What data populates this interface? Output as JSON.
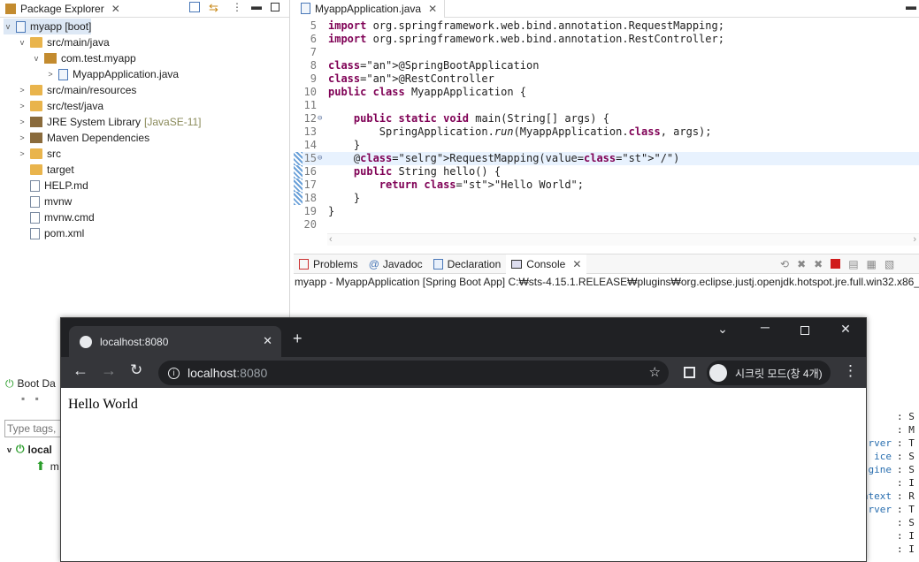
{
  "package_explorer": {
    "title": "Package Explorer",
    "items": [
      {
        "label": "myapp [boot]",
        "indent": 0,
        "twisty": "v",
        "icon": "project",
        "selected": true
      },
      {
        "label": "src/main/java",
        "indent": 1,
        "twisty": "v",
        "icon": "srcfolder"
      },
      {
        "label": "com.test.myapp",
        "indent": 2,
        "twisty": "v",
        "icon": "package"
      },
      {
        "label": "MyappApplication.java",
        "indent": 3,
        "twisty": ">",
        "icon": "java"
      },
      {
        "label": "src/main/resources",
        "indent": 1,
        "twisty": ">",
        "icon": "srcfolder"
      },
      {
        "label": "src/test/java",
        "indent": 1,
        "twisty": ">",
        "icon": "srcfolder"
      },
      {
        "label": "JRE System Library",
        "deco": "[JavaSE-11]",
        "indent": 1,
        "twisty": ">",
        "icon": "library"
      },
      {
        "label": "Maven Dependencies",
        "indent": 1,
        "twisty": ">",
        "icon": "library"
      },
      {
        "label": "src",
        "indent": 1,
        "twisty": ">",
        "icon": "folder"
      },
      {
        "label": "target",
        "indent": 1,
        "twisty": "",
        "icon": "folder"
      },
      {
        "label": "HELP.md",
        "indent": 1,
        "twisty": "",
        "icon": "file"
      },
      {
        "label": "mvnw",
        "indent": 1,
        "twisty": "",
        "icon": "file"
      },
      {
        "label": "mvnw.cmd",
        "indent": 1,
        "twisty": "",
        "icon": "file"
      },
      {
        "label": "pom.xml",
        "indent": 1,
        "twisty": "",
        "icon": "file"
      }
    ]
  },
  "editor": {
    "tab_label": "MyappApplication.java",
    "lines": [
      {
        "n": "5",
        "text": "import org.springframework.web.bind.annotation.RequestMapping;"
      },
      {
        "n": "6",
        "text": "import org.springframework.web.bind.annotation.RestController;"
      },
      {
        "n": "7",
        "text": ""
      },
      {
        "n": "8",
        "text": "@SpringBootApplication"
      },
      {
        "n": "9",
        "text": "@RestController"
      },
      {
        "n": "10",
        "text": "public class MyappApplication {"
      },
      {
        "n": "11",
        "text": ""
      },
      {
        "n": "12",
        "text": "    public static void main(String[] args) {"
      },
      {
        "n": "13",
        "text": "        SpringApplication.run(MyappApplication.class, args);"
      },
      {
        "n": "14",
        "text": "    }"
      },
      {
        "n": "15",
        "text": "    @RequestMapping(value=\"/\")"
      },
      {
        "n": "16",
        "text": "    public String hello() {"
      },
      {
        "n": "17",
        "text": "        return \"Hello World\";"
      },
      {
        "n": "18",
        "text": "    }"
      },
      {
        "n": "19",
        "text": "}"
      },
      {
        "n": "20",
        "text": ""
      }
    ]
  },
  "console_panel": {
    "tabs": [
      "Problems",
      "Javadoc",
      "Declaration",
      "Console"
    ],
    "active_tab": "Console",
    "description": "myapp - MyappApplication [Spring Boot App] C:₩sts-4.15.1.RELEASE₩plugins₩org.eclipse.justj.openjdk.hotspot.jre.full.win32.x86_6",
    "log_right": [
      {
        "k": "",
        "v": ": S"
      },
      {
        "k": "",
        "v": ": M"
      },
      {
        "k": "rver",
        "v": ": T"
      },
      {
        "k": "ice",
        "v": ": S"
      },
      {
        "k": "gine",
        "v": ": S"
      },
      {
        "k": "",
        "v": ": I"
      },
      {
        "k": "ntext",
        "v": ": R"
      },
      {
        "k": "rver",
        "v": ": T"
      },
      {
        "k": "",
        "v": ": S"
      },
      {
        "k": "",
        "v": ": I"
      },
      {
        "k": "",
        "v": ": I"
      }
    ]
  },
  "boot_dashboard": {
    "title": "Boot Da",
    "filter_placeholder": "Type tags,",
    "item": "local",
    "sub": "m"
  },
  "browser": {
    "tab_title": "localhost:8080",
    "url_host": "localhost",
    "url_port": ":8080",
    "incognito_label": "시크릿 모드(창 4개)",
    "page_text": "Hello World"
  }
}
